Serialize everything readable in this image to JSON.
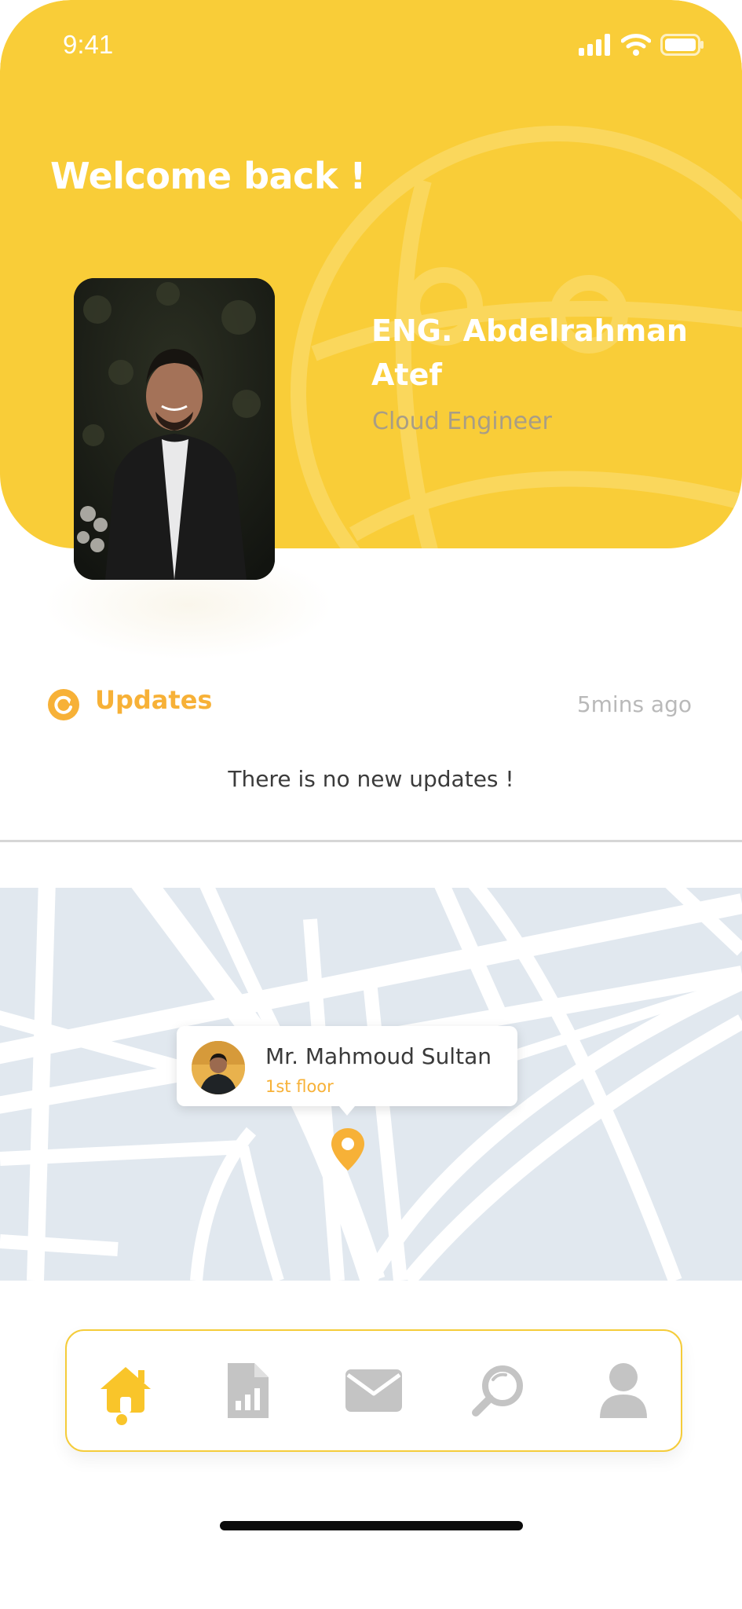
{
  "status_bar": {
    "time": "9:41"
  },
  "header": {
    "welcome": "Welcome back !",
    "profile_name": "ENG. Abdelrahman Atef",
    "profile_role": "Cloud Engineer"
  },
  "updates": {
    "title": "Updates",
    "time_ago": "5mins ago",
    "empty_message": "There is no new updates !"
  },
  "map": {
    "person_name": "Mr. Mahmoud Sultan",
    "person_location": "1st floor"
  },
  "tabbar": {
    "items": [
      {
        "icon": "home-icon",
        "active": true
      },
      {
        "icon": "report-icon",
        "active": false
      },
      {
        "icon": "mail-icon",
        "active": false
      },
      {
        "icon": "search-icon",
        "active": false
      },
      {
        "icon": "profile-icon",
        "active": false
      }
    ]
  },
  "colors": {
    "accent": "#f9cd38",
    "accent_text": "#f7b137",
    "inactive_icon": "#c4c4c4",
    "map_bg": "#e1e8ef"
  }
}
